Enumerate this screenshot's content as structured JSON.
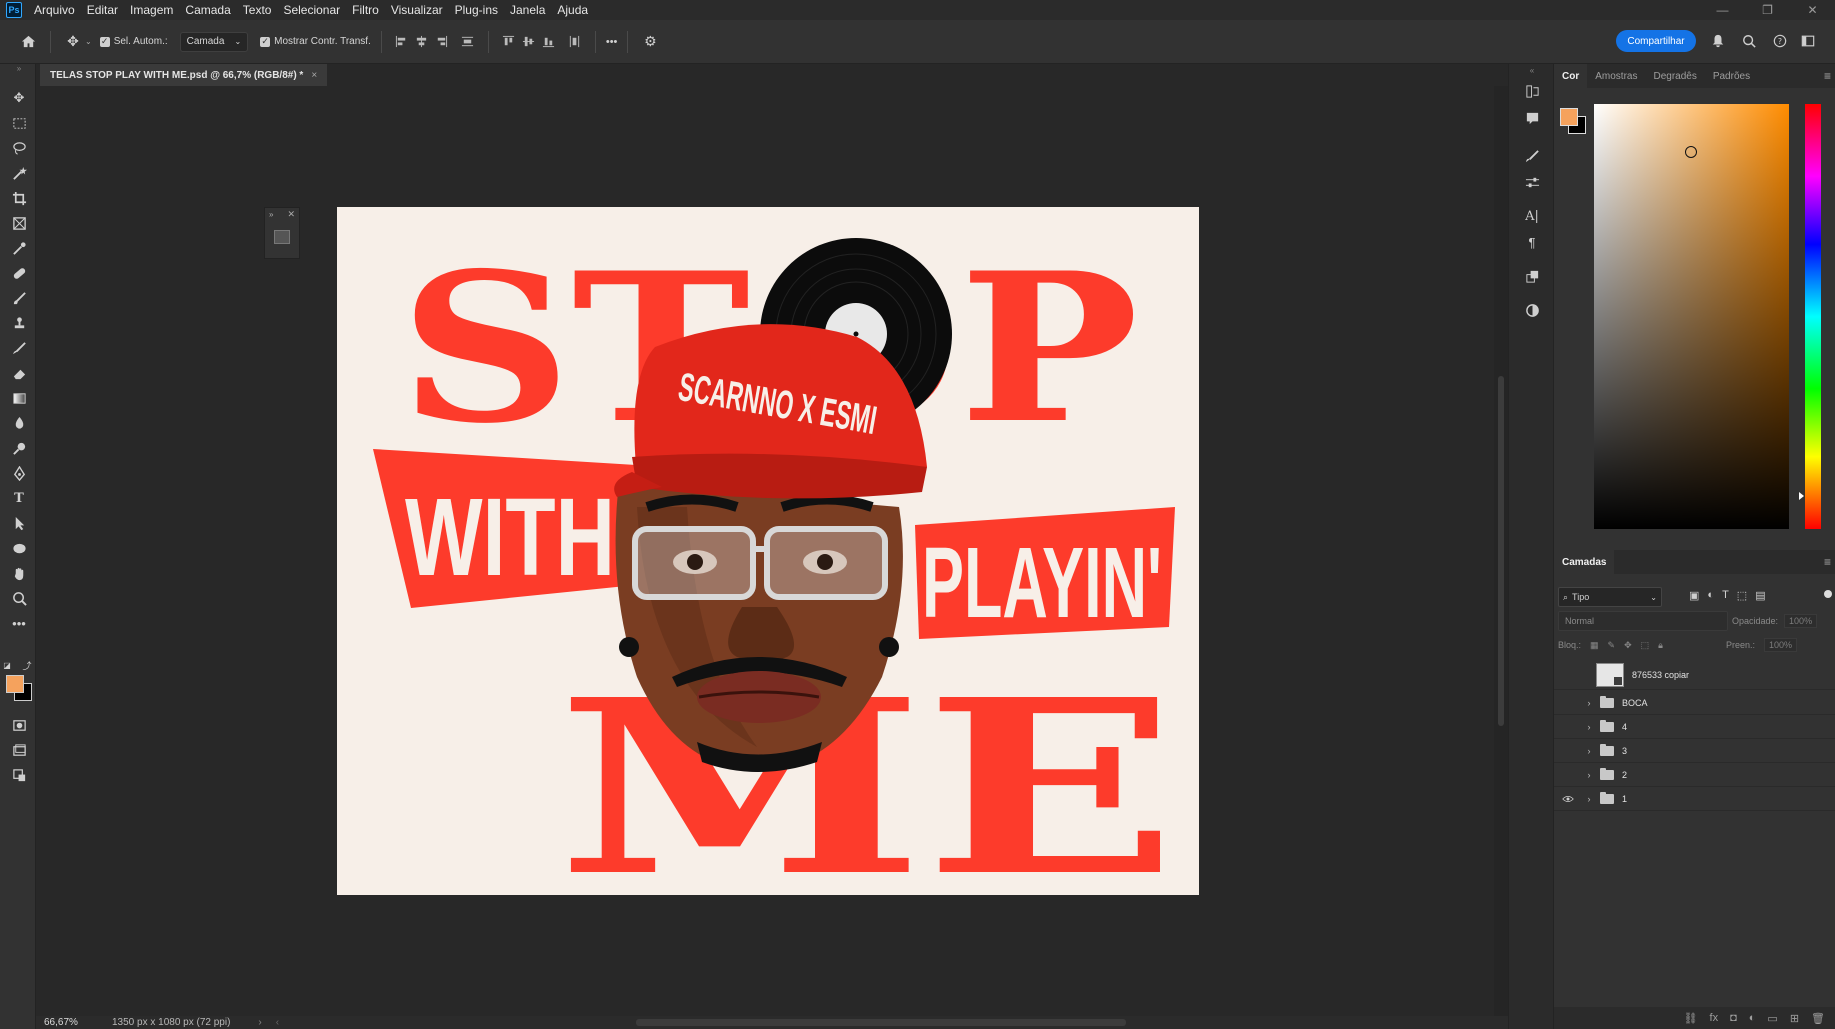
{
  "menu": {
    "items": [
      "Arquivo",
      "Editar",
      "Imagem",
      "Camada",
      "Texto",
      "Selecionar",
      "Filtro",
      "Visualizar",
      "Plug-ins",
      "Janela",
      "Ajuda"
    ]
  },
  "app": {
    "logo": "Ps"
  },
  "options": {
    "auto_select_label": "Sel. Autom.:",
    "auto_select_checked": true,
    "target_value": "Camada",
    "show_transform_label": "Mostrar Contr. Transf.",
    "show_transform_checked": true,
    "more_label": "•••",
    "share_label": "Compartilhar"
  },
  "document": {
    "tab_title": "TELAS STOP PLAY WITH ME.psd @ 66,7% (RGB/8#) *",
    "close_glyph": "×",
    "zoom": "66,67%",
    "dimensions": "1350 px x 1080 px (72 ppi)"
  },
  "artwork": {
    "word_stop": "STOP",
    "word_with": "WITH",
    "word_playin": "PLAYIN'",
    "word_me": "ME",
    "cap_text": "SCARNNO X ESMI"
  },
  "color_panel": {
    "tabs": [
      "Cor",
      "Amostras",
      "Degradês",
      "Padrões"
    ],
    "active_tab": "Cor",
    "foreground": "#f5a25d",
    "background": "#000000"
  },
  "layers_panel": {
    "title": "Camadas",
    "filter_label": "Tipo",
    "blend_mode": "Normal",
    "opacity_label": "Opacidade:",
    "opacity_value": "100%",
    "lock_label": "Bloq.:",
    "fill_label": "Preen.:",
    "fill_value": "100%",
    "layers": [
      {
        "name": "876533 copiar",
        "type": "smart",
        "visible": false
      },
      {
        "name": "BOCA",
        "type": "group",
        "visible": false
      },
      {
        "name": "4",
        "type": "group",
        "visible": false
      },
      {
        "name": "3",
        "type": "group",
        "visible": false
      },
      {
        "name": "2",
        "type": "group",
        "visible": false
      },
      {
        "name": "1",
        "type": "group",
        "visible": true
      }
    ]
  },
  "colors": {
    "accent_red": "#fd3b2b",
    "artboard_bg": "#f7efe8",
    "share_blue": "#1473e6"
  }
}
